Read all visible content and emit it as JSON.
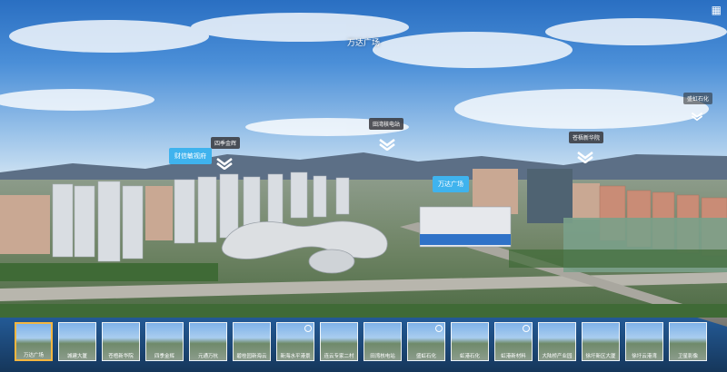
{
  "scene": {
    "title": "万达广场",
    "hotspots": [
      {
        "label": "四季金辉",
        "style": "dark"
      },
      {
        "label": "财信敏视府",
        "style": "blue"
      },
      {
        "label": "田湾核电站",
        "style": "dark"
      },
      {
        "label": "万达广场",
        "style": "blue"
      },
      {
        "label": "苍梧新华院",
        "style": "dark"
      },
      {
        "label": "盛虹石化",
        "style": "plain"
      }
    ]
  },
  "thumbnails": [
    {
      "label": "万达广场",
      "active": true
    },
    {
      "label": "城建大厦",
      "active": false
    },
    {
      "label": "苍梧新华院",
      "active": false
    },
    {
      "label": "四季金辉",
      "active": false
    },
    {
      "label": "元通万杭",
      "active": false
    },
    {
      "label": "碧桂园新海云",
      "active": false
    },
    {
      "label": "新海水平港景",
      "active": false
    },
    {
      "label": "连云专家二村",
      "active": false
    },
    {
      "label": "田湾核电站",
      "active": false
    },
    {
      "label": "盛虹石化",
      "active": false
    },
    {
      "label": "虹港石化",
      "active": false
    },
    {
      "label": "虹港新材料",
      "active": false
    },
    {
      "label": "大陆桥产业园",
      "active": false
    },
    {
      "label": "徐圩新区大厦",
      "active": false
    },
    {
      "label": "徐圩云港湾",
      "active": false
    },
    {
      "label": "卫星影像",
      "active": false
    }
  ],
  "colors": {
    "accent": "#f4b640",
    "hotspot_blue": "#3fb3ee"
  },
  "icons": {
    "down": "chevron-down-icon",
    "gallery": "gallery-icon",
    "fullscreen": "fullscreen-icon"
  }
}
